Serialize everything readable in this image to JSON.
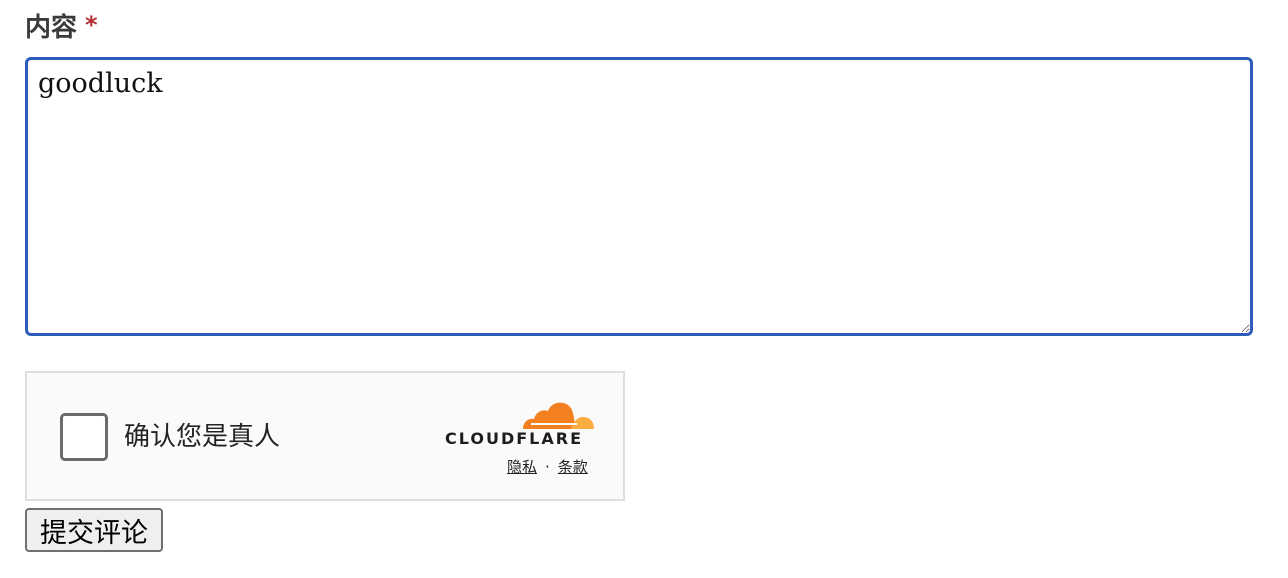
{
  "form": {
    "content_label": "内容",
    "required_mark": "*",
    "content_value": "goodluck"
  },
  "captcha": {
    "checkbox_label": "确认您是真人",
    "brand": "CLOUDFLARE",
    "privacy_link": "隐私",
    "separator": "·",
    "terms_link": "条款",
    "brand_colors": {
      "orange": "#f38020",
      "light_orange": "#fbad41"
    },
    "icons": [
      "cloudflare-logo-icon"
    ]
  },
  "submit": {
    "label": "提交评论"
  },
  "colors": {
    "focus_border": "#2f5cb8",
    "required": "#b32d2e"
  }
}
